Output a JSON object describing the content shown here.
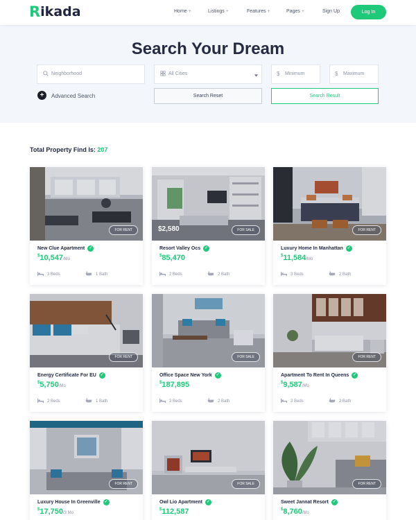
{
  "header": {
    "logo_mark": "R",
    "logo_text": "ikada",
    "nav": [
      {
        "label": "Home",
        "has_dropdown": true
      },
      {
        "label": "Listings",
        "has_dropdown": true
      },
      {
        "label": "Features",
        "has_dropdown": true
      },
      {
        "label": "Pages",
        "has_dropdown": true
      },
      {
        "label": "Sign Up",
        "has_dropdown": false
      }
    ],
    "dropdown_glyph": "+",
    "login_label": "Log In"
  },
  "hero": {
    "title": "Search Your Dream",
    "neighborhood_placeholder": "Neighborhood",
    "cities_placeholder": "All Cities",
    "minimum_placeholder": "Minimum",
    "maximum_placeholder": "Maximum",
    "currency_glyph": "$",
    "advanced_search_label": "Advanced Search",
    "search_reset_label": "Search Reset",
    "search_result_label": "Search Result"
  },
  "results": {
    "total_label": "Total Property Find Is:",
    "total_count": "207"
  },
  "colors": {
    "accent": "#1ec97a",
    "heading": "#262b44",
    "hero_bg": "#f3f7fb"
  },
  "listings": [
    {
      "title": "New Clue Apartment",
      "tag": "FOR RENT",
      "photo_price": "",
      "currency": "$",
      "price": "10,547",
      "period": "/Mo",
      "beds": "3 Beds",
      "baths": "1 Bath",
      "scene": "living"
    },
    {
      "title": "Resort Valley Ocs",
      "tag": "FOR SALE",
      "photo_price": "$2,580",
      "currency": "$",
      "price": "85,470",
      "period": "",
      "beds": "2 Beds",
      "baths": "2 Bath",
      "scene": "shelves"
    },
    {
      "title": "Luxury Home In Manhattan",
      "tag": "FOR RENT",
      "photo_price": "",
      "currency": "$",
      "price": "11,584",
      "period": "/Mo",
      "beds": "3 Beds",
      "baths": "2 Bath",
      "scene": "bedroom"
    },
    {
      "title": "Energy Certificate For EU",
      "tag": "FOR RENT",
      "photo_price": "",
      "currency": "$",
      "price": "5,750",
      "period": "/Mo",
      "beds": "2 Beds",
      "baths": "1 Bath",
      "scene": "bedroom2"
    },
    {
      "title": "Office Space New York",
      "tag": "FOR SALE",
      "photo_price": "",
      "currency": "$",
      "price": "187,895",
      "period": "",
      "beds": "3 Beds",
      "baths": "2 Bath",
      "scene": "sofa"
    },
    {
      "title": "Apartment To Rent In Queens",
      "tag": "FOR RENT",
      "photo_price": "",
      "currency": "$",
      "price": "9,587",
      "period": "/Mo",
      "beds": "3 Beds",
      "baths": "2 Bath",
      "scene": "kitchen"
    },
    {
      "title": "Luxury House In Greenville",
      "tag": "FOR RENT",
      "photo_price": "",
      "currency": "$",
      "price": "17,750",
      "period": "/3 Mo",
      "beds": "",
      "baths": "",
      "scene": "lounge"
    },
    {
      "title": "Owl Lio Apartment",
      "tag": "FOR SALE",
      "photo_price": "",
      "currency": "$",
      "price": "112,587",
      "period": "",
      "beds": "",
      "baths": "",
      "scene": "tvroom"
    },
    {
      "title": "Sweet Jannat Resort",
      "tag": "FOR RENT",
      "photo_price": "",
      "currency": "$",
      "price": "8,760",
      "period": "/Mo",
      "beds": "",
      "baths": "",
      "scene": "plant"
    }
  ],
  "icons": {
    "search": "search-icon",
    "bed": "bed-icon",
    "bath": "bath-icon",
    "verified": "verified-check-icon",
    "plus": "plus-circle-icon",
    "caret": "caret-down-icon"
  }
}
